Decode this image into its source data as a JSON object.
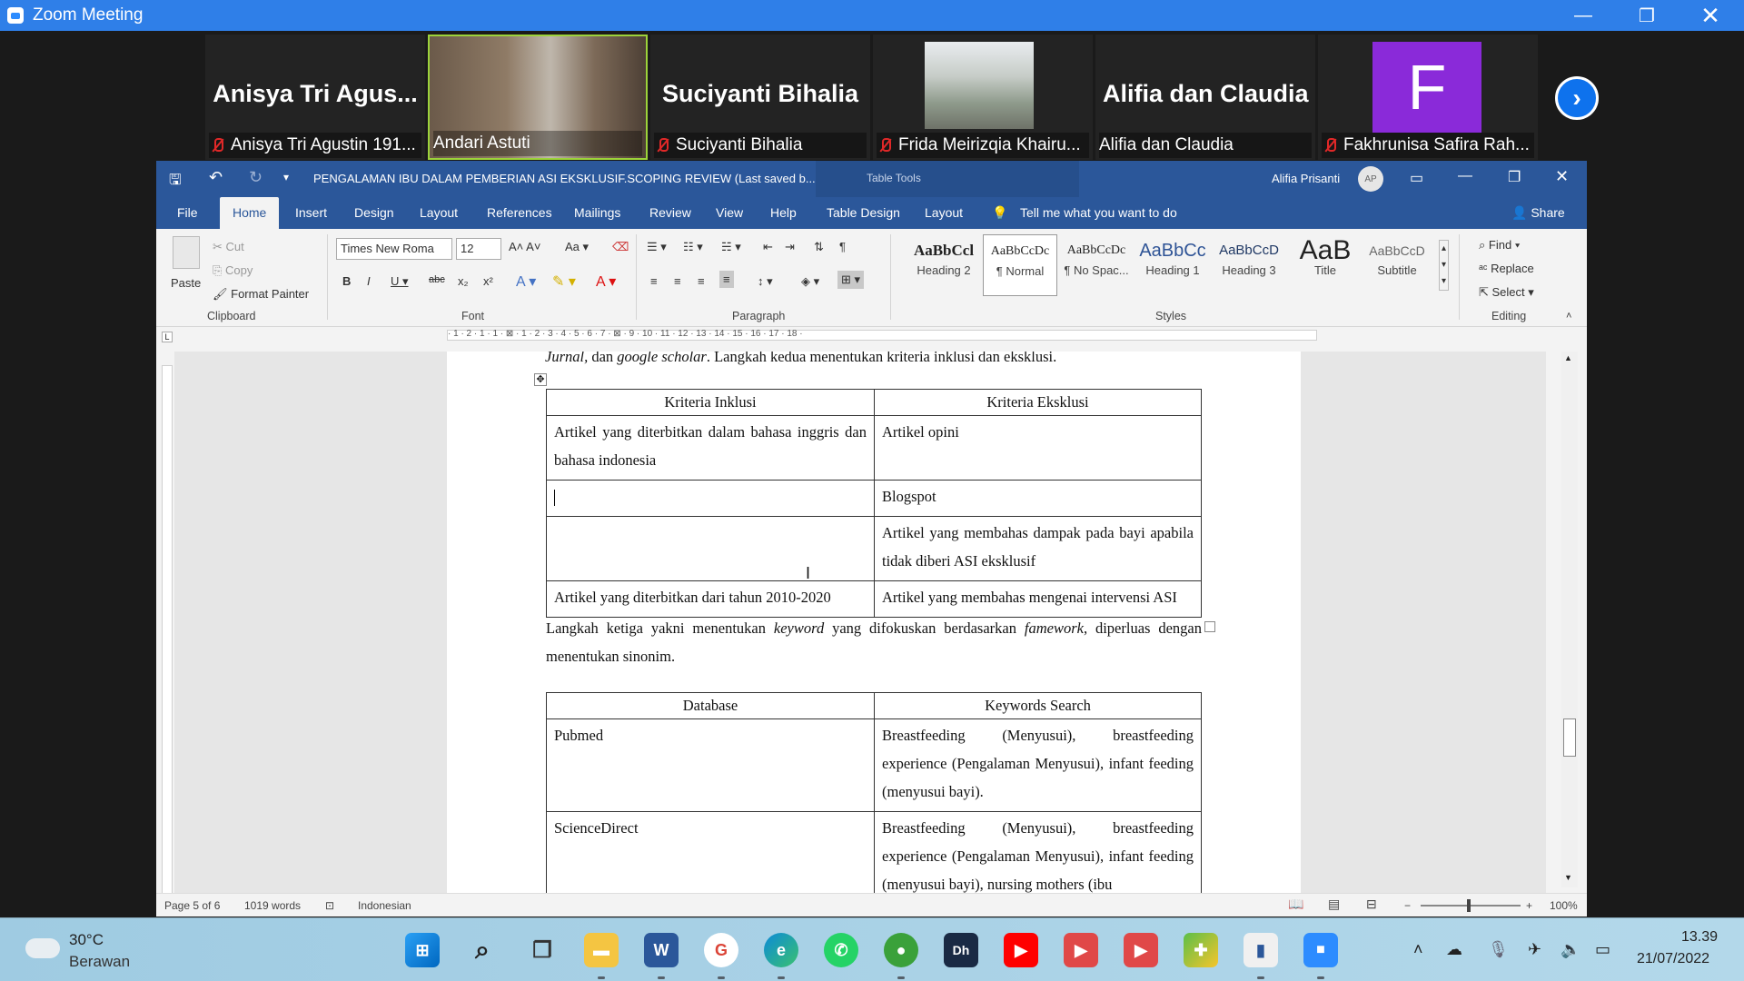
{
  "zoom": {
    "window_title": "Zoom Meeting",
    "participants": [
      {
        "big_name": "Anisya  Tri  Agus...",
        "caption": "Anisya Tri Agustin 191...",
        "muted": true
      },
      {
        "big_name": "",
        "caption": "Andari Astuti",
        "muted": false
      },
      {
        "big_name": "Suciyanti Bihalia",
        "caption": "Suciyanti Bihalia",
        "muted": true
      },
      {
        "big_name": "",
        "caption": "Frida Meirizqia Khairu...",
        "muted": true
      },
      {
        "big_name": "Alifia dan Claudia",
        "caption": "Alifia dan Claudia",
        "muted": false
      },
      {
        "big_name": "",
        "avatar_letter": "F",
        "caption": "Fakhrunisa Safira Rah...",
        "muted": true
      }
    ]
  },
  "word": {
    "doc_title": "PENGALAMAN IBU DALAM PEMBERIAN ASI EKSKLUSIF.SCOPING REVIEW (Last saved b...",
    "context_tools": "Table Tools",
    "user_name": "Alifia Prisanti",
    "user_initials": "AP",
    "tabs": [
      "File",
      "Home",
      "Insert",
      "Design",
      "Layout",
      "References",
      "Mailings",
      "Review",
      "View",
      "Help",
      "Table Design",
      "Layout"
    ],
    "tell_me": "Tell me what you want to do",
    "share": "Share",
    "clipboard": {
      "paste": "Paste",
      "cut": "Cut",
      "copy": "Copy",
      "format_painter": "Format Painter",
      "label": "Clipboard"
    },
    "font": {
      "name": "Times New Roma",
      "size": "12",
      "label": "Font"
    },
    "paragraph_label": "Paragraph",
    "styles": [
      {
        "preview": "AaBbCcl",
        "name": "Heading 2"
      },
      {
        "preview": "AaBbCcDc",
        "name": "¶ Normal"
      },
      {
        "preview": "AaBbCcDc",
        "name": "¶ No Spac..."
      },
      {
        "preview": "AaBbCc",
        "name": "Heading 1"
      },
      {
        "preview": "AaBbCcD",
        "name": "Heading 3"
      },
      {
        "preview": "AaB",
        "name": "Title"
      },
      {
        "preview": "AaBbCcD",
        "name": "Subtitle"
      }
    ],
    "styles_label": "Styles",
    "editing": {
      "find": "Find",
      "replace": "Replace",
      "select": "Select",
      "label": "Editing"
    },
    "ruler_text": "· 1 · 2 · 1 · 1 · ⊠ · 1 · 2 · 3 · 4 · 5 · 6 · 7 · ⊠ · 9 · 10 · 11 · 12 · 13 · 14 · 15 · 16 · 17 · 18 ·"
  },
  "document": {
    "line_top": [
      "Jurnal,",
      " dan ",
      "google scholar",
      ". Langkah kedua menentukan kriteria inklusi dan eksklusi."
    ],
    "table1": {
      "headers": [
        "Kriteria Inklusi",
        "Kriteria Eksklusi"
      ],
      "rows": [
        [
          "Artikel yang diterbitkan dalam bahasa inggris dan bahasa indonesia",
          "Artikel opini"
        ],
        [
          "",
          "Blogspot"
        ],
        [
          "",
          "Artikel yang membahas dampak pada bayi apabila tidak diberi ASI eksklusif"
        ],
        [
          "Artikel yang diterbitkan dari tahun 2010-2020",
          "Artikel yang membahas mengenai intervensi ASI"
        ]
      ]
    },
    "para2": [
      "Langkah ketiga yakni menentukan ",
      "keyword",
      " yang difokuskan berdasarkan  ",
      "famework",
      ", diperluas dengan menentukan sinonim."
    ],
    "table2": {
      "headers": [
        "Database",
        "Keywords Search"
      ],
      "rows": [
        [
          "Pubmed",
          "Breastfeeding (Menyusui), breastfeeding experience (Pengalaman Menyusui), infant feeding (menyusui bayi)."
        ],
        [
          "ScienceDirect",
          "Breastfeeding (Menyusui), breastfeeding experience (Pengalaman Menyusui), infant feeding (menyusui bayi), nursing mothers (ibu"
        ]
      ]
    }
  },
  "status": {
    "page": "Page 5 of 6",
    "words": "1019 words",
    "language": "Indonesian",
    "zoom": "100%"
  },
  "taskbar": {
    "temp": "30°C",
    "weather": "Berawan",
    "time": "13.39",
    "date": "21/07/2022"
  },
  "colors": {
    "word_blue": "#2b579a",
    "zoom_blue": "#2d8cff",
    "avatar_purple": "#8a2ad9",
    "mute_red": "#e02828"
  }
}
